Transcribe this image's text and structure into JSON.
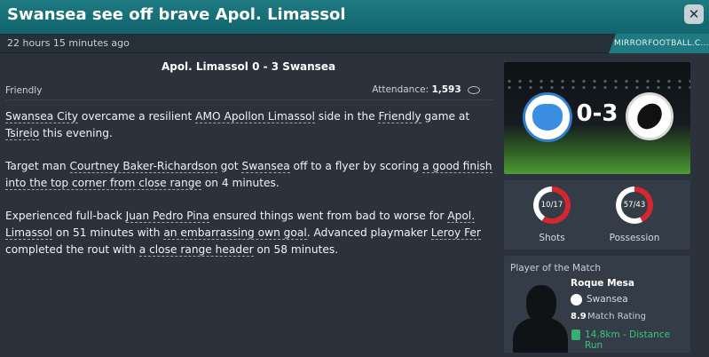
{
  "window": {
    "title": "Swansea see off brave Apol. Limassol",
    "close_glyph": "✕"
  },
  "subbar": {
    "timestamp": "22 hours 15 minutes ago",
    "source": "MIRRORFOOTBALL.C..."
  },
  "article": {
    "headline": "Apol. Limassol 0 - 3 Swansea",
    "competition": "Friendly",
    "attendance_label": "Attendance:",
    "attendance_value": "1,593",
    "p1": {
      "a": "Swansea City",
      "b": " overcame a resilient ",
      "c": "AMO Apollon Limassol",
      "d": " side in the ",
      "e": "Friendly",
      "f": " game at ",
      "g": "Tsireio",
      "h": " this evening."
    },
    "p2": {
      "a": "Target man ",
      "b": "Courtney Baker-Richardson",
      "c": " got ",
      "d": "Swansea",
      "e": " off to a flyer by scoring ",
      "f": "a good finish into the top corner from close range",
      "g": " on 4 minutes."
    },
    "p3": {
      "a": "Experienced full-back ",
      "b": "Juan Pedro Pina",
      "c": " ensured things went from bad to worse for ",
      "d": "Apol. Limassol",
      "e": " on 51 minutes with ",
      "f": "an embarrassing own goal",
      "g": ". Advanced playmaker ",
      "h": "Leroy Fer",
      "i": " completed the rout with ",
      "j": "a close range header",
      "k": " on 58 minutes."
    }
  },
  "score_panel": {
    "score": "0-3"
  },
  "stats": {
    "shots_value": "10/17",
    "shots_label": "Shots",
    "possession_value": "57/43",
    "possession_label": "Possession",
    "shots_home_fraction": 0.41,
    "possession_home_fraction": 0.57,
    "accent_color": "#d6262e"
  },
  "potm": {
    "title": "Player of the Match",
    "name": "Roque Mesa",
    "club": "Swansea",
    "rating": "8.9",
    "rating_label": "Match Rating",
    "distance": "14.8km - Distance Run",
    "distance_color": "#3fc37a"
  },
  "icons": [
    "close-icon",
    "weather-icon",
    "home-crest-icon",
    "away-crest-icon",
    "club-badge-icon",
    "thumbs-up-icon"
  ]
}
